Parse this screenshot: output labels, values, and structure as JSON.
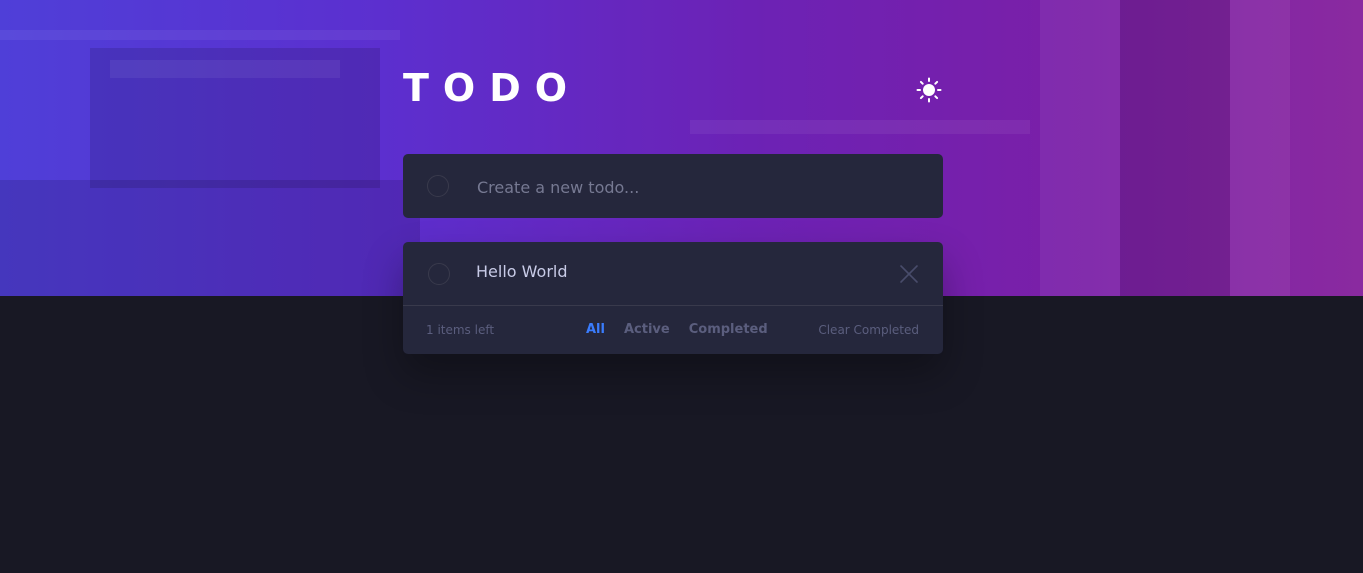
{
  "app": {
    "title": "TODO",
    "theme_toggle_icon": "sun-icon"
  },
  "new_todo": {
    "placeholder": "Create a new todo...",
    "value": ""
  },
  "todos": [
    {
      "text": "Hello World",
      "completed": false
    }
  ],
  "footer": {
    "items_left": "1 items left",
    "filters": [
      {
        "label": "All",
        "active": true
      },
      {
        "label": "Active",
        "active": false
      },
      {
        "label": "Completed",
        "active": false
      }
    ],
    "clear_completed": "Clear Completed"
  },
  "colors": {
    "accent": "#3a7cfd",
    "card": "#25273c",
    "page_bg": "#181824",
    "gradient_start": "#4f3fd8",
    "gradient_end": "#8a2aa0"
  }
}
